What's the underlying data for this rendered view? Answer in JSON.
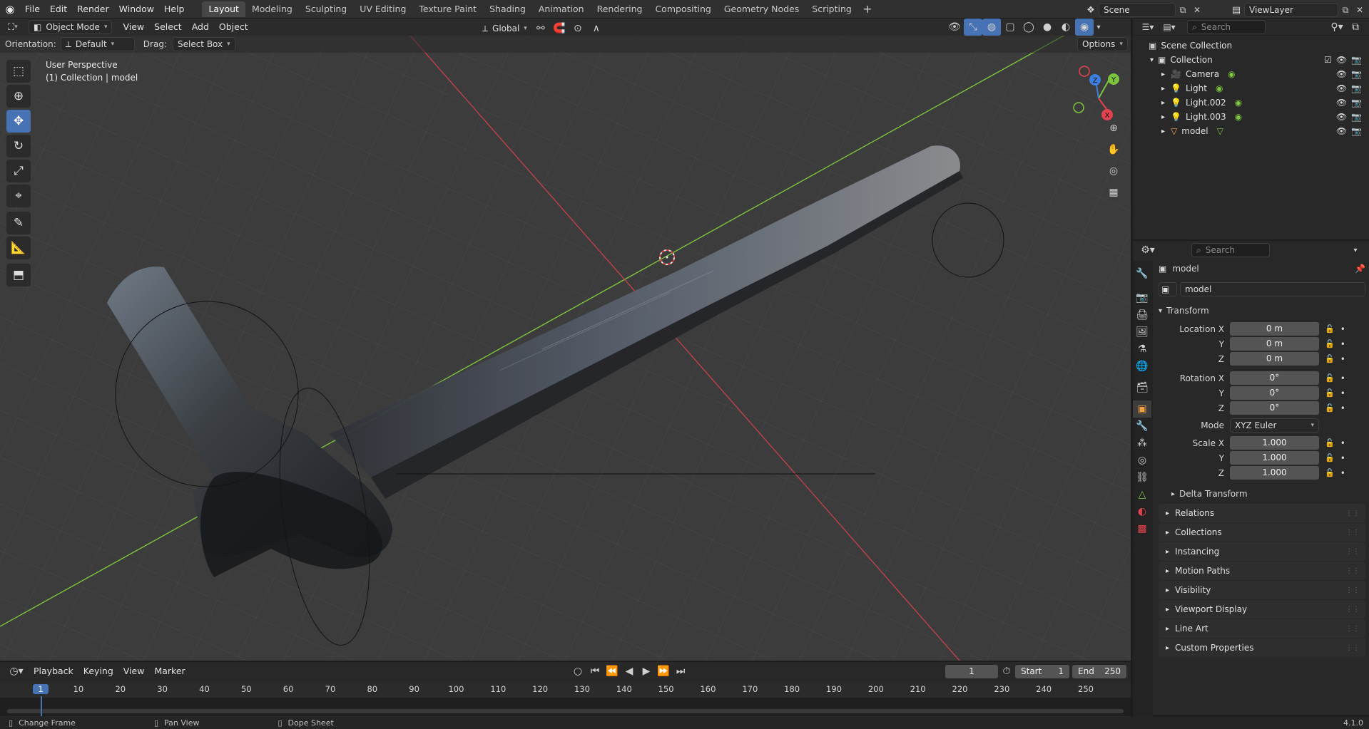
{
  "menu": [
    "File",
    "Edit",
    "Render",
    "Window",
    "Help"
  ],
  "workspaces": [
    "Layout",
    "Modeling",
    "Sculpting",
    "UV Editing",
    "Texture Paint",
    "Shading",
    "Animation",
    "Rendering",
    "Compositing",
    "Geometry Nodes",
    "Scripting"
  ],
  "active_workspace": "Layout",
  "scene": {
    "name": "Scene",
    "view_layer": "ViewLayer"
  },
  "viewport_header": {
    "mode": "Object Mode",
    "menus": [
      "View",
      "Select",
      "Add",
      "Object"
    ],
    "transform_orientation": "Global",
    "orientation_label": "Orientation:",
    "orientation_value": "Default",
    "drag_label": "Drag:",
    "drag_value": "Select Box",
    "options_label": "Options"
  },
  "viewport_overlay_text": {
    "perspective": "User Perspective",
    "context": "(1) Collection | model"
  },
  "gizmo": {
    "x": "X",
    "y": "Y",
    "z": "Z"
  },
  "outliner": {
    "search_placeholder": "Search",
    "root": "Scene Collection",
    "collection": "Collection",
    "items": [
      {
        "name": "Camera",
        "icon": "camera-icon"
      },
      {
        "name": "Light",
        "icon": "light-icon"
      },
      {
        "name": "Light.002",
        "icon": "light-icon"
      },
      {
        "name": "Light.003",
        "icon": "light-icon"
      },
      {
        "name": "model",
        "icon": "mesh-icon"
      }
    ]
  },
  "properties": {
    "search_placeholder": "Search",
    "object_name": "model",
    "datablock_name": "model",
    "transform_title": "Transform",
    "location": {
      "label": "Location X",
      "x": "0 m",
      "y": "0 m",
      "z": "0 m"
    },
    "rotation": {
      "label": "Rotation X",
      "x": "0°",
      "y": "0°",
      "z": "0°"
    },
    "mode_label": "Mode",
    "mode_value": "XYZ Euler",
    "scale": {
      "label": "Scale X",
      "x": "1.000",
      "y": "1.000",
      "z": "1.000"
    },
    "axis_y": "Y",
    "axis_z": "Z",
    "delta_transform": "Delta Transform",
    "sections": [
      "Relations",
      "Collections",
      "Instancing",
      "Motion Paths",
      "Visibility",
      "Viewport Display",
      "Line Art",
      "Custom Properties"
    ]
  },
  "timeline": {
    "menus": [
      "Playback",
      "Keying",
      "View",
      "Marker"
    ],
    "current_frame": "1",
    "start_label": "Start",
    "start_value": "1",
    "end_label": "End",
    "end_value": "250",
    "ticks": [
      "1",
      "10",
      "20",
      "30",
      "40",
      "50",
      "60",
      "70",
      "80",
      "90",
      "100",
      "110",
      "120",
      "130",
      "140",
      "150",
      "160",
      "170",
      "180",
      "190",
      "200",
      "210",
      "220",
      "230",
      "240",
      "250"
    ]
  },
  "statusbar": {
    "change_frame": "Change Frame",
    "pan_view": "Pan View",
    "dope_sheet": "Dope Sheet",
    "version": "4.1.0"
  },
  "colors": {
    "accent": "#4772b3",
    "x_axis": "#e2434e",
    "y_axis": "#7cc43e",
    "z_axis": "#3c7fe0",
    "mesh": "#a5e03d"
  }
}
